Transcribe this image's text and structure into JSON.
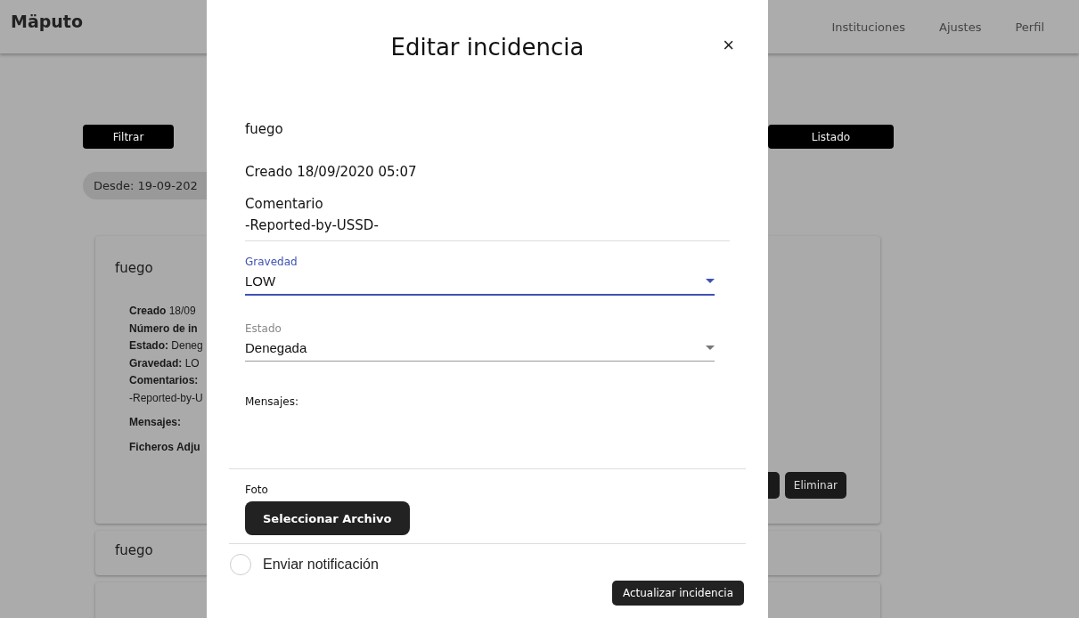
{
  "header": {
    "logo": "Mäputo",
    "nav": [
      "Instituciones",
      "Ajustes",
      "Perfil"
    ]
  },
  "toolbar": {
    "filter_button": "Filtrar",
    "view_button": "Listado"
  },
  "filter_chip": "Desde: 19-09-202",
  "cards": [
    {
      "title": "fuego",
      "expanded": true,
      "details": [
        {
          "kind": "field",
          "label": "Creado",
          "value": "18/09"
        },
        {
          "kind": "field",
          "label": "Número de in"
        },
        {
          "kind": "field",
          "label": "Estado:",
          "value": "Deneg"
        },
        {
          "kind": "field",
          "label": "Gravedad:",
          "value": "LO"
        },
        {
          "kind": "field",
          "label": "Comentarios:"
        },
        {
          "kind": "text",
          "value": "-Reported-by-U"
        },
        {
          "kind": "section",
          "label": "Mensajes:"
        },
        {
          "kind": "section",
          "label": "Ficheros Adju"
        }
      ],
      "buttons": [
        "Eliminar"
      ]
    },
    {
      "title": "fuego",
      "expanded": false
    },
    {
      "expanded": false
    }
  ],
  "modal": {
    "title": "Editar incidencia",
    "close": "×",
    "name": "fuego",
    "created": "Creado 18/09/2020 05:07",
    "comment_label": "Comentario",
    "comment": "-Reported-by-USSD-",
    "selects": [
      {
        "label": "Gravedad",
        "value": "LOW",
        "focused": true
      },
      {
        "label": "Estado",
        "value": "Denegada",
        "focused": false
      }
    ],
    "messages_label": "Mensajes:",
    "photo_label": "Foto",
    "file_button": "Seleccionar Archivo",
    "notify": {
      "label": "Enviar notificación",
      "checked": false
    },
    "submit": "Actualizar incidencia"
  }
}
